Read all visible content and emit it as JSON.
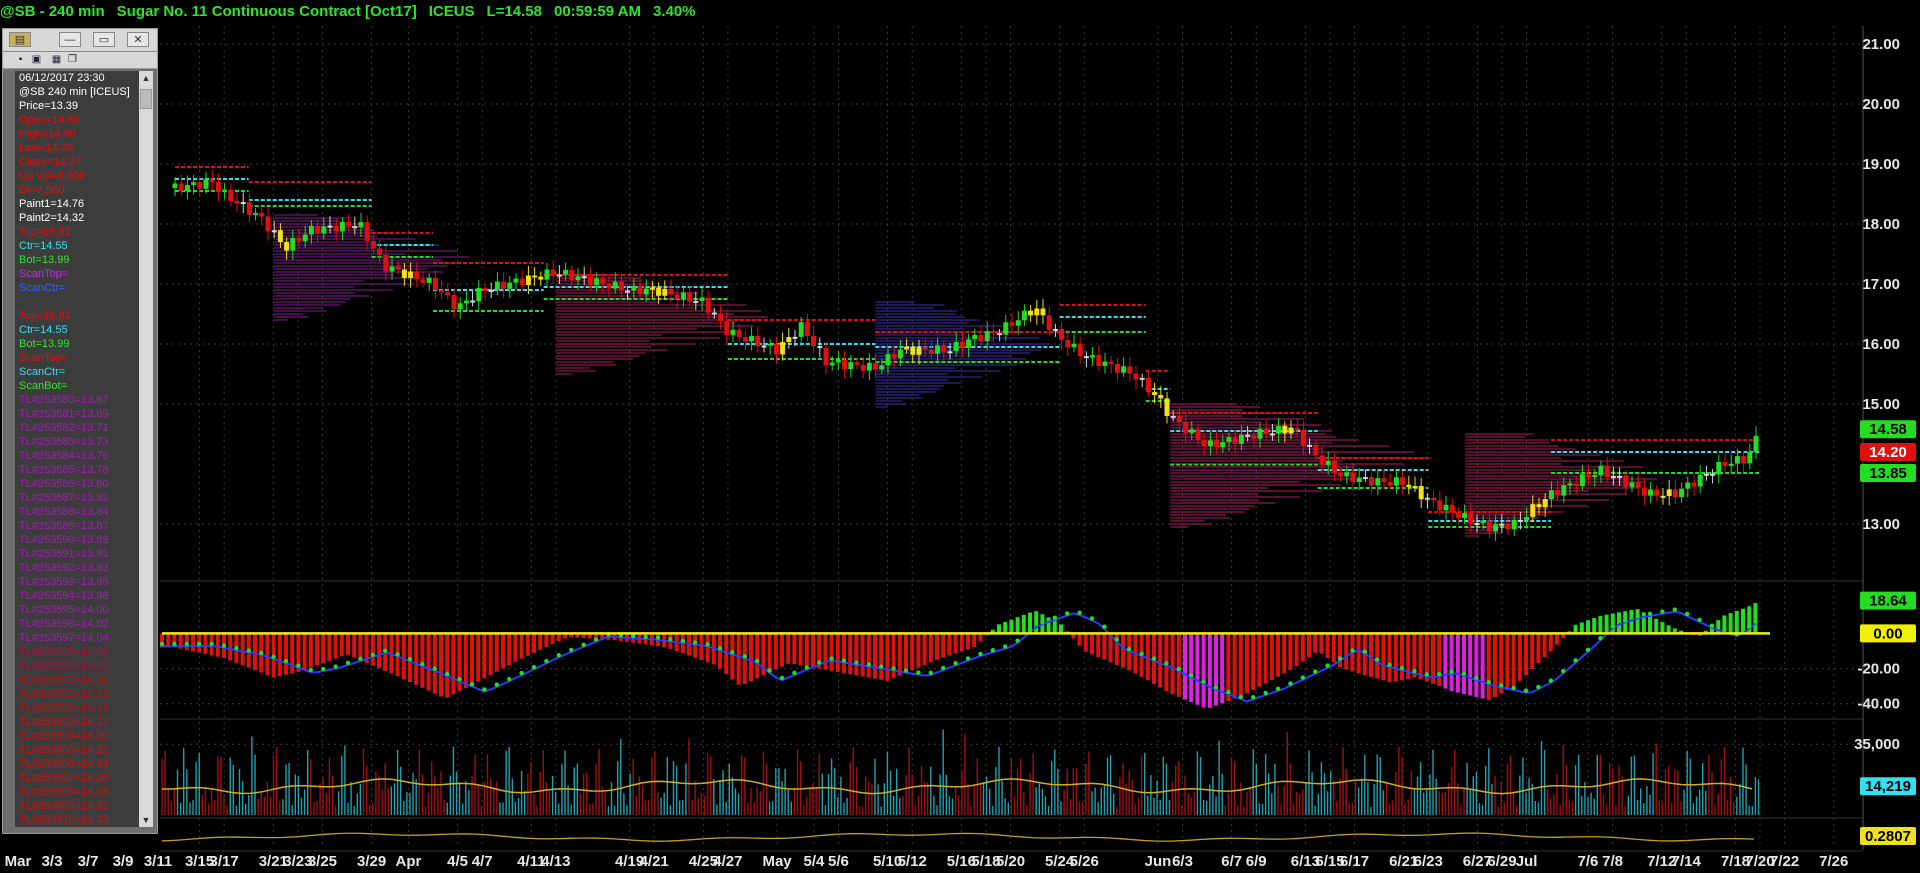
{
  "window": {
    "symbol_title": "@SB - 240 min",
    "description": "Sugar No. 11 Continuous Contract [Oct17]",
    "exchange": "ICEUS",
    "last": "L=14.58",
    "time": "00:59:59 AM",
    "change": "3.40%"
  },
  "data_window": {
    "lines": [
      {
        "text": "06/12/2017 23:30",
        "color": "#ffffff"
      },
      {
        "text": "@SB 240 min [ICEUS]",
        "color": "#ffffff"
      },
      {
        "text": "Price=13.39",
        "color": "#ffffff"
      },
      {
        "text": "Open=14.60",
        "color": "#e01010"
      },
      {
        "text": "High=14.90",
        "color": "#e01010"
      },
      {
        "text": "Low=14.30",
        "color": "#e01010"
      },
      {
        "text": "Close=14.37",
        "color": "#e01010"
      },
      {
        "text": "Up Vol=6,000",
        "color": "#e01010"
      },
      {
        "text": "OI=7,960",
        "color": "#e01010"
      },
      {
        "text": "Paint1=14.76",
        "color": "#ffffff"
      },
      {
        "text": "Paint2=14.32",
        "color": "#ffffff"
      },
      {
        "text": "Top=15.82",
        "color": "#e01010"
      },
      {
        "text": "Ctr=14.55",
        "color": "#33e0f0"
      },
      {
        "text": "Bot=13.99",
        "color": "#2ee62e"
      },
      {
        "text": "ScanTop=",
        "color": "#c030e0"
      },
      {
        "text": "ScanCtr=",
        "color": "#3060ff"
      },
      {
        "text": "",
        "color": "#ffffff"
      },
      {
        "text": "Top=15.82",
        "color": "#e01010"
      },
      {
        "text": "Ctr=14.55",
        "color": "#33e0f0"
      },
      {
        "text": "Bot=13.99",
        "color": "#2ee62e"
      },
      {
        "text": "ScanTop=",
        "color": "#e01010"
      },
      {
        "text": "ScanCtr=",
        "color": "#33e0f0"
      },
      {
        "text": "ScanBot=",
        "color": "#2ee62e"
      },
      {
        "text": "TL#253580=13.67",
        "color": "#a020b0"
      },
      {
        "text": "TL#253581=13.69",
        "color": "#a020b0"
      },
      {
        "text": "TL#253582=13.71",
        "color": "#a020b0"
      },
      {
        "text": "TL#253583=13.73",
        "color": "#a020b0"
      },
      {
        "text": "TL#253584=13.76",
        "color": "#a020b0"
      },
      {
        "text": "TL#253585=13.78",
        "color": "#a020b0"
      },
      {
        "text": "TL#253586=13.80",
        "color": "#a020b0"
      },
      {
        "text": "TL#253587=13.82",
        "color": "#a020b0"
      },
      {
        "text": "TL#253588=13.84",
        "color": "#a020b0"
      },
      {
        "text": "TL#253589=13.87",
        "color": "#a020b0"
      },
      {
        "text": "TL#253590=13.89",
        "color": "#a020b0"
      },
      {
        "text": "TL#253591=13.91",
        "color": "#a020b0"
      },
      {
        "text": "TL#253592=13.93",
        "color": "#a020b0"
      },
      {
        "text": "TL#253593=13.95",
        "color": "#a020b0"
      },
      {
        "text": "TL#253594=13.98",
        "color": "#a020b0"
      },
      {
        "text": "TL#253595=14.00",
        "color": "#a020b0"
      },
      {
        "text": "TL#253596=14.02",
        "color": "#a020b0"
      },
      {
        "text": "TL#253597=14.04",
        "color": "#a020b0"
      },
      {
        "text": "TL#253598=14.06",
        "color": "#b01040"
      },
      {
        "text": "TL#253599=14.09",
        "color": "#b01040"
      },
      {
        "text": "TL#253600=14.11",
        "color": "#c01010"
      },
      {
        "text": "TL#253601=14.13",
        "color": "#c01010"
      },
      {
        "text": "TL#253602=14.15",
        "color": "#c01010"
      },
      {
        "text": "TL#253603=14.17",
        "color": "#d01010"
      },
      {
        "text": "TL#253604=14.20",
        "color": "#d01010"
      },
      {
        "text": "TL#253605=14.22",
        "color": "#d01010"
      },
      {
        "text": "TL#253606=14.24",
        "color": "#d01010"
      },
      {
        "text": "TL#253607=14.26",
        "color": "#d01010"
      },
      {
        "text": "TL#253608=14.28",
        "color": "#d01010"
      },
      {
        "text": "TL#253609=14.31",
        "color": "#d01010"
      },
      {
        "text": "TL#253610=14.33",
        "color": "#d01010"
      }
    ]
  },
  "colors": {
    "background": "#000000",
    "up": "#22dd22",
    "down": "#e01010",
    "neutral": "#d8d8d8",
    "paint": "#f0e020",
    "cyan": "#33e0f0",
    "grid": "#3a3a3a",
    "zero_line": "#f0f000"
  },
  "chart_data": [
    {
      "type": "candlestick",
      "title": "@SB - 240 min Sugar No. 11 Continuous Contract [Oct17]",
      "y_ticks": [
        "21.00",
        "20.00",
        "19.00",
        "18.00",
        "17.00",
        "16.00",
        "15.00",
        "13.00"
      ],
      "ylim": [
        12.1,
        21.3
      ],
      "last_labels": [
        {
          "text": "14.58",
          "value": 14.58,
          "color": "#22dd22"
        },
        {
          "text": "14.20",
          "value": 14.2,
          "color": "#e01010"
        },
        {
          "text": "13.85",
          "value": 13.85,
          "color": "#22dd22"
        }
      ],
      "close_path": [
        [
          "3/13",
          18.6
        ],
        [
          "3/16",
          18.7
        ],
        [
          "3/17",
          18.5
        ],
        [
          "3/20",
          18.1
        ],
        [
          "3/22",
          17.6
        ],
        [
          "3/24",
          17.9
        ],
        [
          "3/28",
          18.0
        ],
        [
          "3/30",
          17.3
        ],
        [
          "4/3",
          17.0
        ],
        [
          "4/5",
          16.6
        ],
        [
          "4/7",
          16.9
        ],
        [
          "4/11",
          17.1
        ],
        [
          "4/13",
          17.2
        ],
        [
          "4/17",
          17.0
        ],
        [
          "4/19",
          16.9
        ],
        [
          "4/21",
          16.9
        ],
        [
          "4/25",
          16.7
        ],
        [
          "4/27",
          16.2
        ],
        [
          "5/1",
          15.9
        ],
        [
          "5/3",
          16.3
        ],
        [
          "5/5",
          15.7
        ],
        [
          "5/9",
          15.6
        ],
        [
          "5/11",
          15.9
        ],
        [
          "5/15",
          15.9
        ],
        [
          "5/17",
          16.1
        ],
        [
          "5/19",
          16.2
        ],
        [
          "5/22",
          16.6
        ],
        [
          "5/24",
          16.1
        ],
        [
          "5/26",
          15.8
        ],
        [
          "5/30",
          15.5
        ],
        [
          "6/1",
          15.1
        ],
        [
          "6/2",
          14.8
        ],
        [
          "6/5",
          14.3
        ],
        [
          "6/7",
          14.4
        ],
        [
          "6/9",
          14.5
        ],
        [
          "6/12",
          14.6
        ],
        [
          "6/14",
          14.1
        ],
        [
          "6/16",
          13.8
        ],
        [
          "6/19",
          13.7
        ],
        [
          "6/21",
          13.7
        ],
        [
          "6/23",
          13.4
        ],
        [
          "6/26",
          13.1
        ],
        [
          "6/28",
          12.95
        ],
        [
          "6/30",
          13.0
        ],
        [
          "7/3",
          13.5
        ],
        [
          "7/5",
          13.7
        ],
        [
          "7/7",
          13.9
        ],
        [
          "7/11",
          13.5
        ],
        [
          "7/13",
          13.5
        ],
        [
          "7/17",
          14.0
        ],
        [
          "7/19",
          14.1
        ],
        [
          "7/20",
          14.58
        ]
      ],
      "levels": [
        {
          "from": "3/13",
          "to": "3/19",
          "top": 18.95,
          "ctr": 18.75,
          "bot": 18.55
        },
        {
          "from": "3/19",
          "to": "3/29",
          "top": 18.7,
          "ctr": 18.4,
          "bot": 18.3
        },
        {
          "from": "3/29",
          "to": "4/3",
          "top": 17.85,
          "ctr": 17.65,
          "bot": 17.45
        },
        {
          "from": "4/3",
          "to": "4/12",
          "top": 17.35,
          "ctr": 16.9,
          "bot": 16.55
        },
        {
          "from": "4/12",
          "to": "4/27",
          "top": 17.15,
          "ctr": 16.95,
          "bot": 16.75
        },
        {
          "from": "4/27",
          "to": "5/9",
          "top": 16.4,
          "ctr": 16.0,
          "bot": 15.75
        },
        {
          "from": "5/9",
          "to": "5/24",
          "top": 16.2,
          "ctr": 15.95,
          "bot": 15.7
        },
        {
          "from": "5/24",
          "to": "5/31",
          "top": 16.65,
          "ctr": 16.45,
          "bot": 16.2
        },
        {
          "from": "5/31",
          "to": "6/2",
          "top": 15.55,
          "ctr": 15.25,
          "bot": 15.05
        },
        {
          "from": "6/2",
          "to": "6/14",
          "top": 14.85,
          "ctr": 14.55,
          "bot": 13.99
        },
        {
          "from": "6/14",
          "to": "6/23",
          "top": 14.1,
          "ctr": 13.9,
          "bot": 13.6
        },
        {
          "from": "6/23",
          "to": "7/3",
          "top": 13.2,
          "ctr": 13.05,
          "bot": 12.95
        },
        {
          "from": "7/3",
          "to": "7/20",
          "top": 14.4,
          "ctr": 14.2,
          "bot": 13.85
        }
      ],
      "volume_profiles": [
        {
          "start": "3/21",
          "ylo": 16.4,
          "yhi": 18.2,
          "width": 9,
          "color": "#7a1a80"
        },
        {
          "start": "4/13",
          "ylo": 15.5,
          "yhi": 17.2,
          "width": 10,
          "color": "#9a1a55"
        },
        {
          "start": "5/9",
          "ylo": 14.95,
          "yhi": 16.75,
          "width": 8,
          "color": "#3a2aa0"
        },
        {
          "start": "6/2",
          "ylo": 12.95,
          "yhi": 15.05,
          "width": 11,
          "color": "#a01a60"
        },
        {
          "start": "6/26",
          "ylo": 12.8,
          "yhi": 14.55,
          "width": 9,
          "color": "#a01a55"
        }
      ]
    },
    {
      "type": "histogram",
      "title": "Momentum oscillator",
      "y_ticks": [
        "-20.00",
        "-40.00"
      ],
      "ylim": [
        -47,
        27
      ],
      "last_labels": [
        {
          "text": "18.64",
          "value": 18.64,
          "color": "#22dd22"
        },
        {
          "text": "0.00",
          "value": 0.0,
          "color": "#f0f000"
        }
      ],
      "values": [
        [
          "3/13",
          -8
        ],
        [
          "3/17",
          -14
        ],
        [
          "3/21",
          -25
        ],
        [
          "3/23",
          -22
        ],
        [
          "3/27",
          -12
        ],
        [
          "3/31",
          -24
        ],
        [
          "4/4",
          -37
        ],
        [
          "4/6",
          -30
        ],
        [
          "4/10",
          -15
        ],
        [
          "4/14",
          -2
        ],
        [
          "4/18",
          -4
        ],
        [
          "4/22",
          -8
        ],
        [
          "4/26",
          -18
        ],
        [
          "4/28",
          -30
        ],
        [
          "5/2",
          -17
        ],
        [
          "5/6",
          -22
        ],
        [
          "5/10",
          -27
        ],
        [
          "5/14",
          -15
        ],
        [
          "5/17",
          -8
        ],
        [
          "5/19",
          5
        ],
        [
          "5/22",
          13
        ],
        [
          "5/24",
          6
        ],
        [
          "5/26",
          -10
        ],
        [
          "5/30",
          -22
        ],
        [
          "6/2",
          -34
        ],
        [
          "6/5",
          -43
        ],
        [
          "6/8",
          -35
        ],
        [
          "6/12",
          -20
        ],
        [
          "6/14",
          -10
        ],
        [
          "6/16",
          -20
        ],
        [
          "6/20",
          -28
        ],
        [
          "6/22",
          -25
        ],
        [
          "6/25",
          -33
        ],
        [
          "6/28",
          -38
        ],
        [
          "6/30",
          -30
        ],
        [
          "7/3",
          -10
        ],
        [
          "7/5",
          5
        ],
        [
          "7/7",
          10
        ],
        [
          "7/10",
          14
        ],
        [
          "7/13",
          3
        ],
        [
          "7/15",
          -2
        ],
        [
          "7/17",
          10
        ],
        [
          "7/19",
          15
        ],
        [
          "7/20",
          18.64
        ]
      ]
    },
    {
      "type": "bar",
      "title": "Volume",
      "y_ticks": [
        "35,000"
      ],
      "ylim": [
        0,
        45000
      ],
      "last_labels": [
        {
          "text": "14,219",
          "value": 14219,
          "color": "#33e0f0"
        }
      ],
      "average_level": 14219
    },
    {
      "type": "line",
      "title": "Lower indicator",
      "last_labels": [
        {
          "text": "0.2807",
          "value": 0.2807,
          "color": "#f0e020"
        }
      ]
    }
  ],
  "x_axis": {
    "labels": [
      "Mar",
      "3/3",
      "3/7",
      "3/9",
      "3/11",
      "3/15",
      "3/17",
      "3/21",
      "3/23",
      "3/25",
      "3/29",
      "Apr",
      "4/5",
      "4/7",
      "4/11",
      "4/13",
      "4/19",
      "4/21",
      "4/25",
      "4/27",
      "May",
      "5/4",
      "5/6",
      "5/10",
      "5/12",
      "5/16",
      "5/18",
      "5/20",
      "5/24",
      "5/26",
      "Jun",
      "6/3",
      "6/7",
      "6/9",
      "6/13",
      "6/15",
      "6/17",
      "6/21",
      "6/23",
      "6/27",
      "6/29",
      "Jul",
      "7/6",
      "7/8",
      "7/12",
      "7/14",
      "7/18",
      "7/20",
      "7/22",
      "7/26"
    ]
  }
}
